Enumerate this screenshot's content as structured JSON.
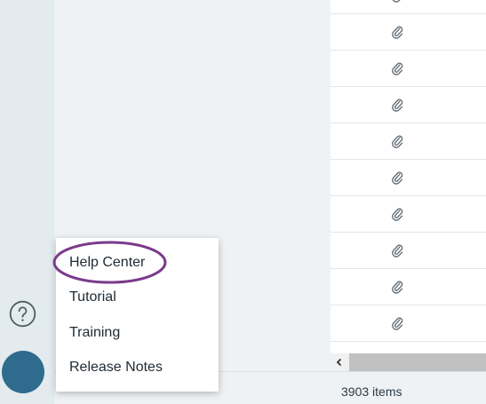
{
  "menu": {
    "items": [
      {
        "label": "Help Center"
      },
      {
        "label": "Tutorial"
      },
      {
        "label": "Training"
      },
      {
        "label": "Release Notes"
      }
    ]
  },
  "table": {
    "attachment_icon": "paperclip-icon",
    "visible_rows": 10
  },
  "footer": {
    "items_count": "3903 items"
  },
  "icons": {
    "help": "question-mark-icon",
    "scroll_left": "chevron-left-icon"
  },
  "colors": {
    "accent_highlight": "#7b3b8c",
    "avatar": "#2f6b8c"
  }
}
